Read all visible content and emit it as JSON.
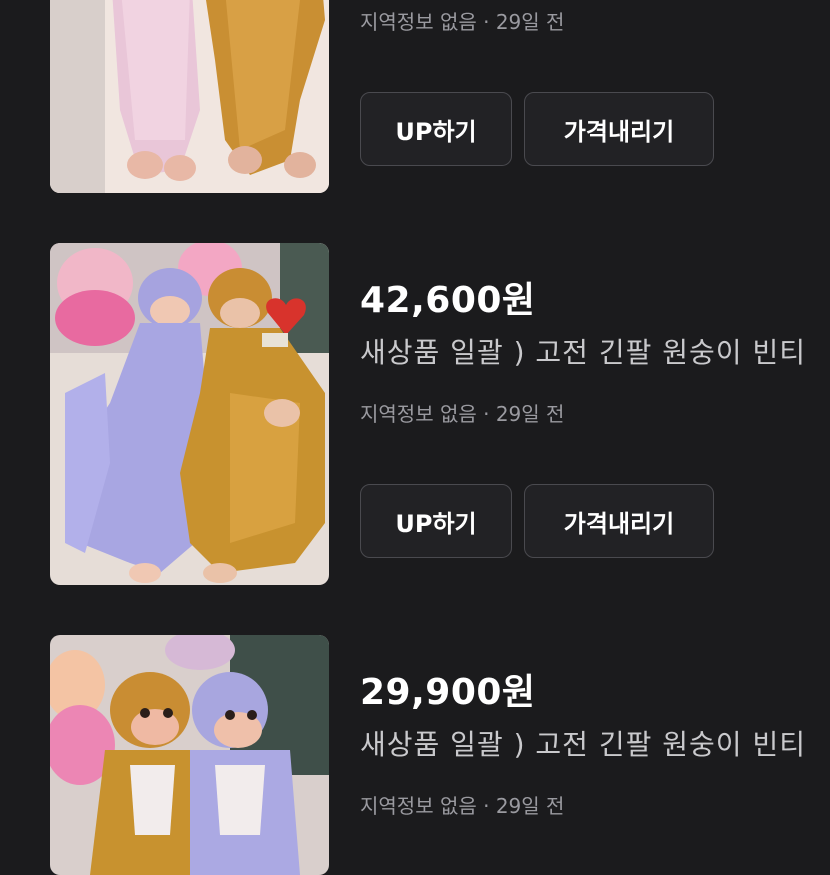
{
  "listings": [
    {
      "price": "",
      "title": "",
      "meta": "지역정보 없음 · 29일 전",
      "up_label": "UP하기",
      "price_down_label": "가격내리기",
      "image_alt": "pink and brown long-arm monkey plush toys"
    },
    {
      "price": "42,600원",
      "title": "새상품 일괄 ) 고전 긴팔 원숭이 빈티",
      "meta": "지역정보 없음 · 29일 전",
      "up_label": "UP하기",
      "price_down_label": "가격내리기",
      "image_alt": "purple and brown long-arm monkey plush toys"
    },
    {
      "price": "29,900원",
      "title": "새상품 일괄 ) 고전 긴팔 원숭이 빈티",
      "meta": "지역정보 없음 · 29일 전",
      "up_label": "",
      "price_down_label": "",
      "image_alt": "brown and purple long-arm monkey plush toys"
    }
  ],
  "colors": {
    "background": "#1b1b1d",
    "button_border": "#4a4a4f",
    "title_text": "#c9c9cc",
    "meta_text": "#9a9aa0"
  }
}
